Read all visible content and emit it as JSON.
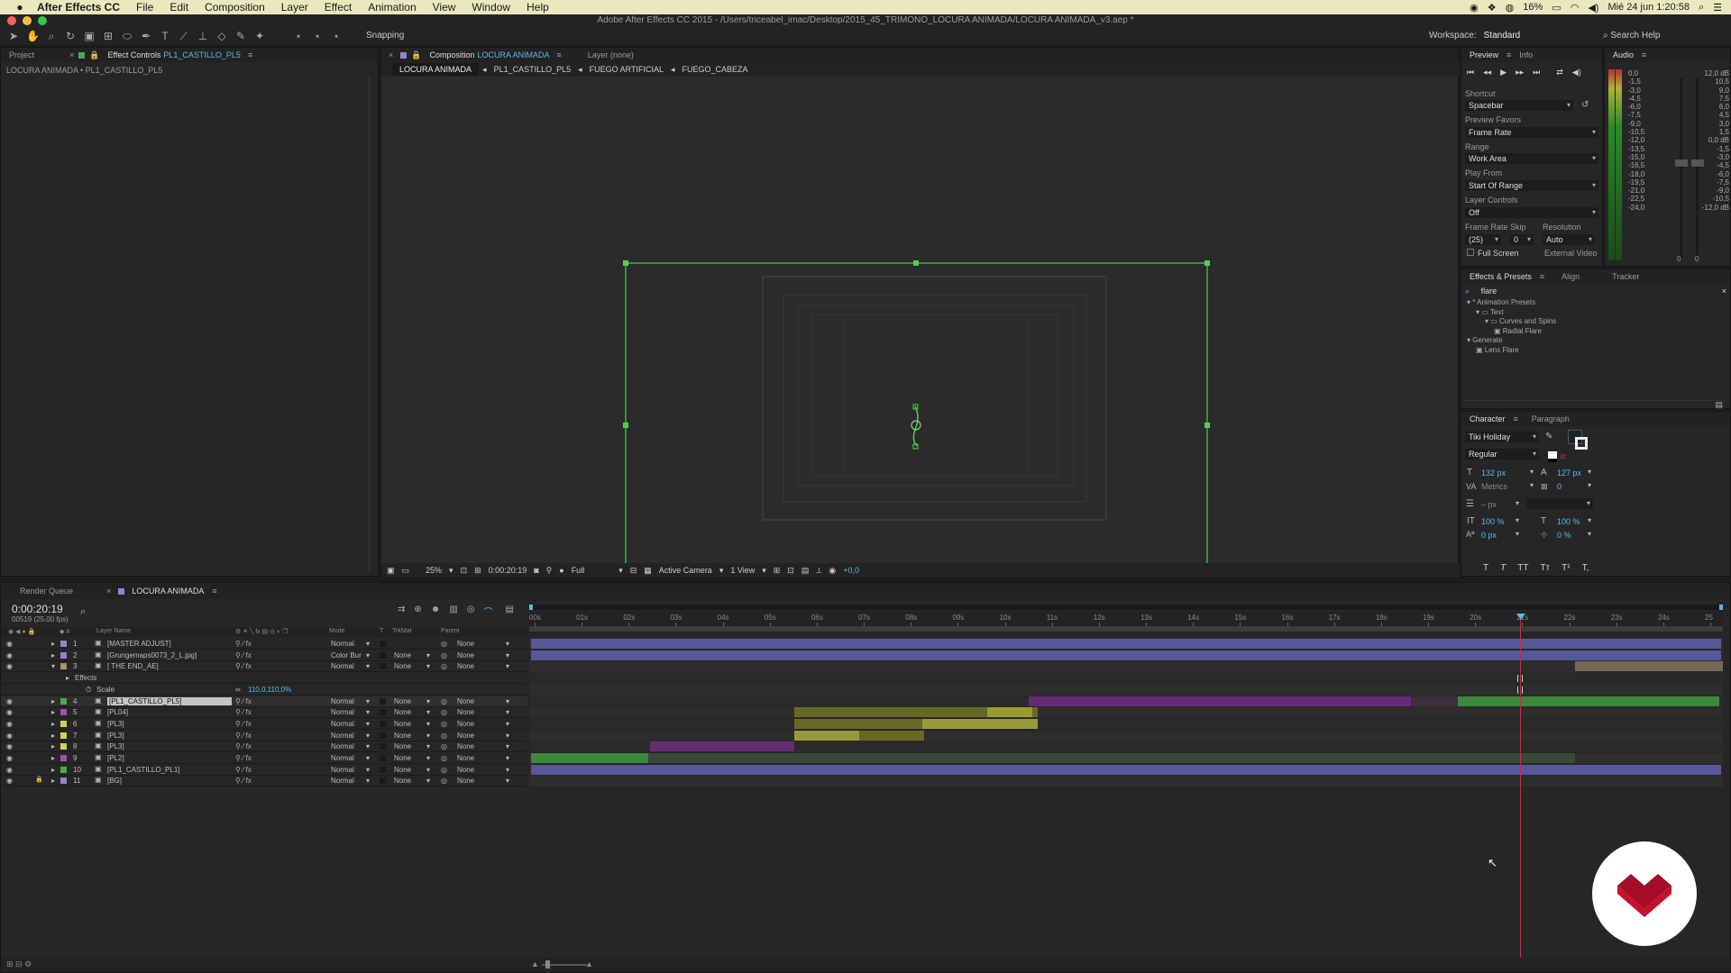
{
  "menubar": {
    "app": "After Effects CC",
    "items": [
      "File",
      "Edit",
      "Composition",
      "Layer",
      "Effect",
      "Animation",
      "View",
      "Window",
      "Help"
    ],
    "battery": "16%",
    "clock": "Mié 24 jun  1:20:58"
  },
  "window": {
    "title": "Adobe After Effects CC 2015 - /Users/triceabel_imac/Desktop/2015_45_TRIMONO_LOCURA ANIMADA/LOCURA ANIMADA_v3.aep *"
  },
  "toolbar": {
    "snapping": "Snapping",
    "workspace_label": "Workspace:",
    "workspace": "Standard",
    "search": "Search Help"
  },
  "left_panel": {
    "tab_project": "Project",
    "tab_effect_controls": "Effect Controls",
    "effect_layer": "PL1_CASTILLO_PL5",
    "breadcrumb": "LOCURA ANIMADA • PL1_CASTILLO_PL5"
  },
  "comp_panel": {
    "tab_label": "Composition",
    "comp_name": "LOCURA ANIMADA",
    "layer_tab": "Layer (none)",
    "crumbs": [
      "LOCURA ANIMADA",
      "PL1_CASTILLO_PL5",
      "FUEGO ARTIFICIAL",
      "FUEGO_CABEZA"
    ],
    "zoom": "25%",
    "timecode": "0:00:20:19",
    "resolution": "Full",
    "camera": "Active Camera",
    "view": "1 View",
    "exposure": "+0,0"
  },
  "preview": {
    "tab_preview": "Preview",
    "tab_info": "Info",
    "shortcut_label": "Shortcut",
    "shortcut": "Spacebar",
    "favors_label": "Preview Favors",
    "favors": "Frame Rate",
    "range_label": "Range",
    "range": "Work Area",
    "playfrom_label": "Play From",
    "playfrom": "Start Of Range",
    "layerctrl_label": "Layer Controls",
    "layerctrl": "Off",
    "fr_label": "Frame Rate",
    "skip_label": "Skip",
    "res_label": "Resolution",
    "fr": "(25)",
    "skip": "0",
    "res": "Auto",
    "fullscreen": "Full Screen",
    "external": "External Video"
  },
  "audio": {
    "tab": "Audio",
    "left_scale": [
      "0,0",
      "-1,5",
      "-3,0",
      "-4,5",
      "-6,0",
      "-7,5",
      "-9,0",
      "-10,5",
      "-12,0",
      "-13,5",
      "-15,0",
      "-16,5",
      "-18,0",
      "-19,5",
      "-21,0",
      "-22,5",
      "-24,0"
    ],
    "right_scale": [
      "12,0 dB",
      "10,5",
      "9,0",
      "7,5",
      "6,0",
      "4,5",
      "3,0",
      "1,5",
      "0,0 dB",
      "-1,5",
      "-3,0",
      "-4,5",
      "-6,0",
      "-7,5",
      "-9,0",
      "-10,5",
      "-12,0 dB"
    ],
    "bottom": [
      "0",
      "0"
    ]
  },
  "effects_presets": {
    "tabs": [
      "Effects & Presets",
      "Align",
      "Tracker"
    ],
    "search": "flare",
    "tree": [
      {
        "label": "* Animation Presets",
        "indent": 0,
        "type": "tri"
      },
      {
        "label": "Text",
        "indent": 1,
        "type": "folder"
      },
      {
        "label": "Curves and Spins",
        "indent": 2,
        "type": "folder"
      },
      {
        "label": "Radial Flare",
        "indent": 3,
        "type": "file"
      },
      {
        "label": "Generate",
        "indent": 0,
        "type": "tri"
      },
      {
        "label": "Lens Flare",
        "indent": 1,
        "type": "file"
      }
    ]
  },
  "character": {
    "tabs": [
      "Character",
      "Paragraph"
    ],
    "font": "Tiki Holiday",
    "style": "Regular",
    "size": "132 px",
    "leading": "127 px",
    "kerning": "Metrics",
    "tracking": "0",
    "stroke": "– px",
    "vscale": "100 %",
    "hscale": "100 %",
    "baseline": "0 px",
    "tsume": "0 %",
    "styles": [
      "T",
      "T",
      "TT",
      "Tт",
      "T¹",
      "T,"
    ]
  },
  "timeline": {
    "tab_render": "Render Queue",
    "tab_comp": "LOCURA ANIMADA",
    "timecode": "0:00:20:19",
    "frames": "00519 (25.00 fps)",
    "col_layer": "Layer Name",
    "col_mode": "Mode",
    "col_t": "T",
    "col_trkmat": "TrkMat",
    "col_parent": "Parent",
    "ruler": [
      "00s",
      "01s",
      "02s",
      "03s",
      "04s",
      "05s",
      "06s",
      "07s",
      "08s",
      "09s",
      "10s",
      "11s",
      "12s",
      "13s",
      "14s",
      "15s",
      "16s",
      "17s",
      "18s",
      "19s",
      "20s",
      "21s",
      "22s",
      "23s",
      "24s",
      "25"
    ],
    "layers": [
      {
        "num": "1",
        "name": "[MASTER ADJUST]",
        "color": "#8888cc",
        "mode": "Normal",
        "trkmat": "",
        "parent": "None",
        "sel": false,
        "lock": false
      },
      {
        "num": "2",
        "name": "[Grungemaps0073_2_L.jpg]",
        "color": "#8888cc",
        "mode": "Color Bur",
        "trkmat": "None",
        "parent": "None",
        "sel": false,
        "lock": false
      },
      {
        "num": "3",
        "name": "[ THE END_AE]",
        "color": "#b09070",
        "mode": "Normal",
        "trkmat": "None",
        "parent": "None",
        "sel": false,
        "lock": false
      },
      {
        "num": "",
        "name": "Effects",
        "color": "",
        "mode": "",
        "trkmat": "",
        "parent": "",
        "sel": false,
        "lock": false,
        "sub": true
      },
      {
        "num": "",
        "name": "Scale",
        "color": "",
        "mode": "",
        "trkmat": "",
        "parent": "",
        "sel": false,
        "lock": false,
        "sub": true,
        "value": "110,0,110,0%"
      },
      {
        "num": "4",
        "name": "[PL1_CASTILLO_PL5]",
        "color": "#4caa4c",
        "mode": "Normal",
        "trkmat": "None",
        "parent": "None",
        "sel": true,
        "lock": false
      },
      {
        "num": "5",
        "name": "[PL04]",
        "color": "#a050b0",
        "mode": "Normal",
        "trkmat": "None",
        "parent": "None",
        "sel": false,
        "lock": false
      },
      {
        "num": "6",
        "name": "[PL3]",
        "color": "#d0d060",
        "mode": "Normal",
        "trkmat": "None",
        "parent": "None",
        "sel": false,
        "lock": false
      },
      {
        "num": "7",
        "name": "[PL3]",
        "color": "#d0d060",
        "mode": "Normal",
        "trkmat": "None",
        "parent": "None",
        "sel": false,
        "lock": false
      },
      {
        "num": "8",
        "name": "[PL3]",
        "color": "#d0d060",
        "mode": "Normal",
        "trkmat": "None",
        "parent": "None",
        "sel": false,
        "lock": false
      },
      {
        "num": "9",
        "name": "[PL2]",
        "color": "#a050b0",
        "mode": "Normal",
        "trkmat": "None",
        "parent": "None",
        "sel": false,
        "lock": false
      },
      {
        "num": "10",
        "name": "[PL1_CASTILLO_PL1]",
        "color": "#4caa4c",
        "mode": "Normal",
        "trkmat": "None",
        "parent": "None",
        "sel": false,
        "lock": false
      },
      {
        "num": "11",
        "name": "[BG]",
        "color": "#8888cc",
        "mode": "Normal",
        "trkmat": "None",
        "parent": "None",
        "sel": false,
        "lock": true
      }
    ]
  },
  "colors": {
    "accent": "#5cb8e6",
    "selection_green": "#4cd04c",
    "bar_blue": "#5a5aa0",
    "bar_green": "#3e8c3e",
    "bar_purple": "#6a2a7a",
    "bar_olive": "#6c6c26",
    "playhead": "#c0304a",
    "logo_red": "#c8102e"
  }
}
